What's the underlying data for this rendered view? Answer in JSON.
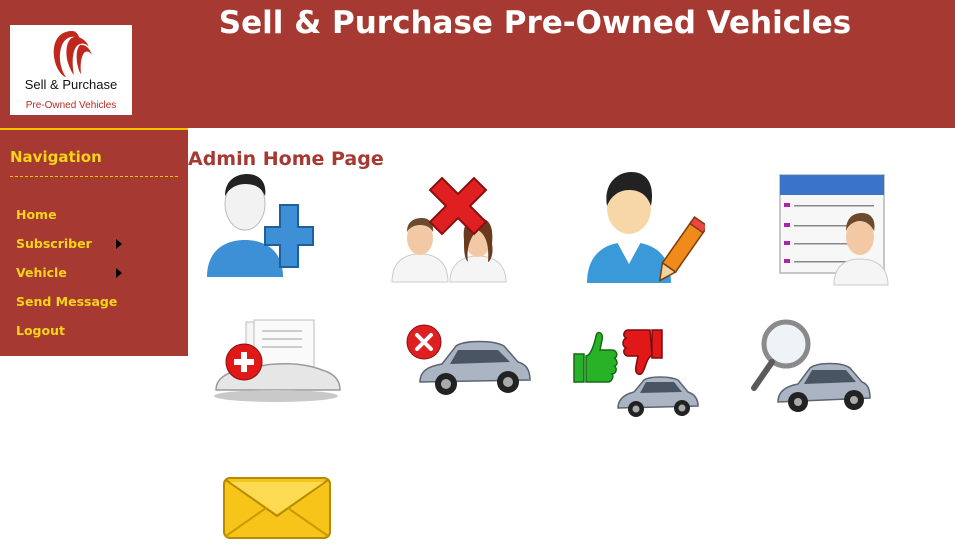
{
  "header": {
    "title": "Sell & Purchase Pre-Owned Vehicles",
    "logo": {
      "line1": "Sell & Purchase",
      "line2": "Pre-Owned Vehicles"
    }
  },
  "sidebar": {
    "title": "Navigation",
    "items": [
      {
        "label": "Home",
        "has_submenu": false
      },
      {
        "label": "Subscriber",
        "has_submenu": true
      },
      {
        "label": "Vehicle",
        "has_submenu": true
      },
      {
        "label": "Send Message",
        "has_submenu": false
      },
      {
        "label": "Logout",
        "has_submenu": false
      }
    ]
  },
  "main": {
    "heading": "Admin Home Page",
    "tiles": [
      {
        "icon": "add-user-icon"
      },
      {
        "icon": "delete-users-icon"
      },
      {
        "icon": "edit-user-icon"
      },
      {
        "icon": "user-list-icon"
      },
      {
        "icon": "add-vehicle-icon"
      },
      {
        "icon": "delete-vehicle-icon"
      },
      {
        "icon": "approve-reject-vehicle-icon"
      },
      {
        "icon": "search-vehicle-icon"
      },
      {
        "icon": "envelope-icon"
      }
    ]
  },
  "colors": {
    "brand": "#a63a33",
    "nav_text": "#f7d417",
    "accent": "#f2c500"
  }
}
